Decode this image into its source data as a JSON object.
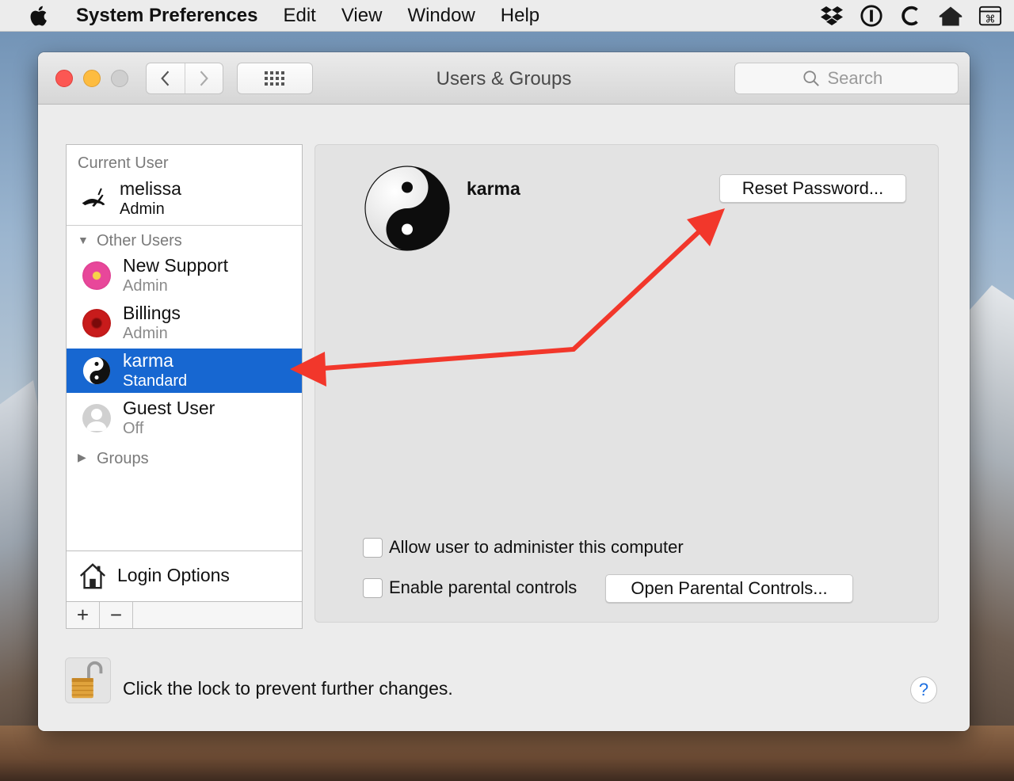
{
  "menubar": {
    "app_name": "System Preferences",
    "items": [
      "Edit",
      "View",
      "Window",
      "Help"
    ]
  },
  "window": {
    "title": "Users & Groups",
    "search_placeholder": "Search"
  },
  "sidebar": {
    "current_user_label": "Current User",
    "current_user": {
      "name": "melissa",
      "role": "Admin"
    },
    "other_users_label": "Other Users",
    "other_users": [
      {
        "name": "New Support",
        "role": "Admin"
      },
      {
        "name": "Billings",
        "role": "Admin"
      },
      {
        "name": "karma",
        "role": "Standard",
        "selected": true
      },
      {
        "name": "Guest User",
        "role": "Off"
      }
    ],
    "groups_label": "Groups",
    "login_options_label": "Login Options",
    "add_label": "+",
    "remove_label": "−"
  },
  "content": {
    "username": "karma",
    "reset_password_label": "Reset Password...",
    "allow_admin_label": "Allow user to administer this computer",
    "parental_controls_label": "Enable parental controls",
    "open_parental_controls_label": "Open Parental Controls..."
  },
  "footer": {
    "lock_text": "Click the lock to prevent further changes.",
    "help_label": "?"
  },
  "colors": {
    "selection": "#1767d1",
    "annotation_arrow": "#f2372b",
    "close": "#fc5753",
    "minimize": "#fdbc40"
  }
}
